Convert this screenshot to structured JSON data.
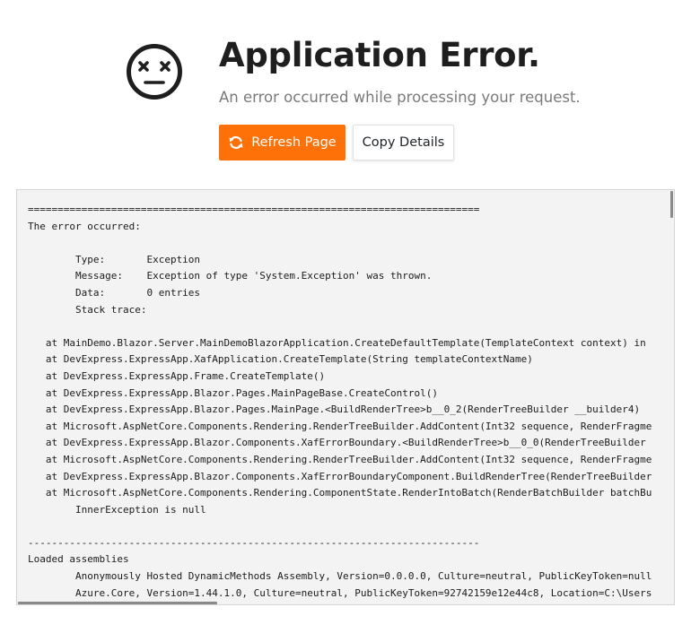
{
  "header": {
    "title": "Application Error.",
    "subtitle": "An error occurred while processing your request.",
    "icon": "dizzy-face-icon"
  },
  "actions": {
    "refresh_label": "Refresh Page",
    "refresh_icon": "refresh-icon",
    "copy_label": "Copy Details"
  },
  "colors": {
    "accent": "#fe7109",
    "details_background": "#f3f3f3",
    "subtitle": "#7a7a7a"
  },
  "details": {
    "lines": [
      "============================================================================",
      "The error occurred:",
      "",
      "\tType:       Exception",
      "\tMessage:    Exception of type 'System.Exception' was thrown.",
      "\tData:       0 entries",
      "\tStack trace:",
      "",
      "   at MainDemo.Blazor.Server.MainDemoBlazorApplication.CreateDefaultTemplate(TemplateContext context) in",
      "   at DevExpress.ExpressApp.XafApplication.CreateTemplate(String templateContextName)",
      "   at DevExpress.ExpressApp.Frame.CreateTemplate()",
      "   at DevExpress.ExpressApp.Blazor.Pages.MainPageBase.CreateControl()",
      "   at DevExpress.ExpressApp.Blazor.Pages.MainPage.<BuildRenderTree>b__0_2(RenderTreeBuilder __builder4)",
      "   at Microsoft.AspNetCore.Components.Rendering.RenderTreeBuilder.AddContent(Int32 sequence, RenderFragme",
      "   at DevExpress.ExpressApp.Blazor.Components.XafErrorBoundary.<BuildRenderTree>b__0_0(RenderTreeBuilder",
      "   at Microsoft.AspNetCore.Components.Rendering.RenderTreeBuilder.AddContent(Int32 sequence, RenderFragme",
      "   at DevExpress.ExpressApp.Blazor.Components.XafErrorBoundaryComponent.BuildRenderTree(RenderTreeBuilder",
      "   at Microsoft.AspNetCore.Components.Rendering.ComponentState.RenderIntoBatch(RenderBatchBuilder batchBu",
      "\tInnerException is null",
      "",
      "----------------------------------------------------------------------------",
      "Loaded assemblies",
      "\tAnonymously Hosted DynamicMethods Assembly, Version=0.0.0.0, Culture=neutral, PublicKeyToken=null",
      "\tAzure.Core, Version=1.44.1.0, Culture=neutral, PublicKeyToken=92742159e12e44c8, Location=C:\\Users"
    ]
  }
}
